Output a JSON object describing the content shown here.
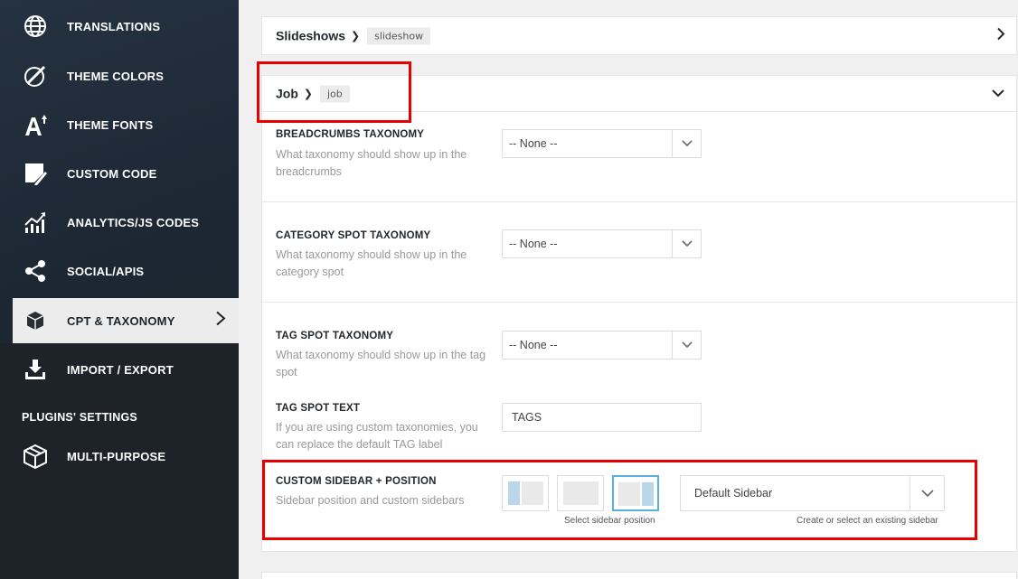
{
  "sidebar": {
    "items": [
      {
        "label": "TRANSLATIONS",
        "icon": "globe-icon"
      },
      {
        "label": "THEME COLORS",
        "icon": "brush-icon"
      },
      {
        "label": "THEME FONTS",
        "icon": "font-icon"
      },
      {
        "label": "CUSTOM CODE",
        "icon": "code-icon"
      },
      {
        "label": "ANALYTICS/JS CODES",
        "icon": "chart-icon"
      },
      {
        "label": "SOCIAL/APIS",
        "icon": "share-icon"
      },
      {
        "label": "CPT & TAXONOMY",
        "icon": "cube-icon",
        "active": true
      },
      {
        "label": "IMPORT / EXPORT",
        "icon": "download-icon"
      }
    ],
    "section_label": "PLUGINS' SETTINGS",
    "plugin_items": [
      {
        "label": "MULTI-PURPOSE",
        "icon": "box-icon"
      }
    ]
  },
  "panels": {
    "slideshows": {
      "title": "Slideshows",
      "tag": "slideshow"
    },
    "job": {
      "title": "Job",
      "tag": "job"
    }
  },
  "fields": {
    "breadcrumbs": {
      "title": "BREADCRUMBS TAXONOMY",
      "desc": "What taxonomy should show up in the breadcrumbs",
      "value": "-- None --"
    },
    "category_spot": {
      "title": "CATEGORY SPOT TAXONOMY",
      "desc": "What taxonomy should show up in the category spot",
      "value": "-- None --"
    },
    "tag_spot": {
      "title": "TAG SPOT TAXONOMY",
      "desc": "What taxonomy should show up in the tag spot",
      "value": "-- None --"
    },
    "tag_text": {
      "title": "TAG SPOT TEXT",
      "desc": "If you are using custom taxonomies, you can replace the default TAG label",
      "value": "TAGS"
    },
    "custom_sidebar": {
      "title": "CUSTOM SIDEBAR + POSITION",
      "desc": "Sidebar position and custom sidebars",
      "position_hint": "Select sidebar position",
      "sidebar_value": "Default Sidebar",
      "sidebar_hint": "Create or select an existing sidebar",
      "selected_position": "right"
    }
  },
  "colors": {
    "highlight": "#e60000",
    "selected": "#5aaee0"
  }
}
